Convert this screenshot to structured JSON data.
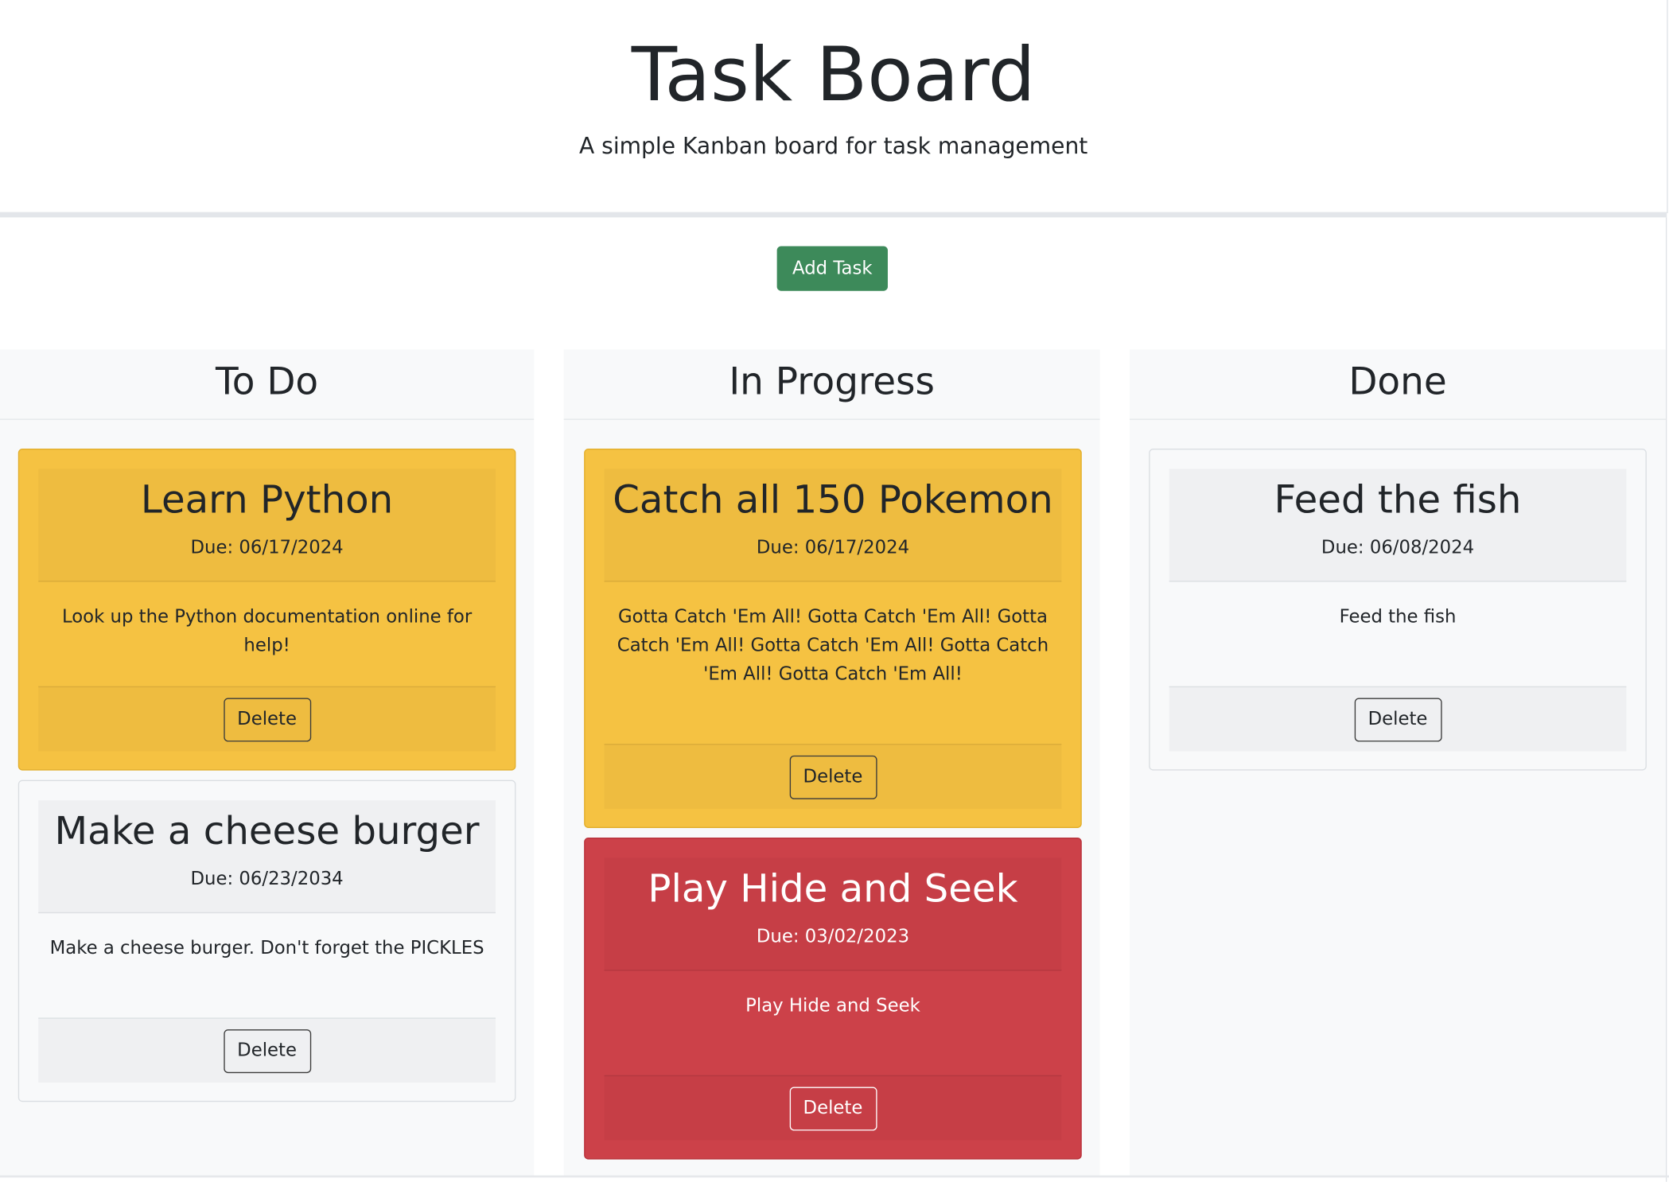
{
  "header": {
    "title": "Task Board",
    "subtitle": "A simple Kanban board for task management"
  },
  "toolbar": {
    "add_task_label": "Add Task"
  },
  "colors": {
    "add_button": "#3d8a5a",
    "warning_card": "#f5c242",
    "overdue_card": "#cc4149",
    "neutral_card": "#f8f9fa"
  },
  "columns": {
    "todo": {
      "title": "To Do",
      "cards": [
        {
          "title": "Learn Python",
          "due": "Due: 06/17/2024",
          "description": "Look up the Python documentation online for help!",
          "delete_label": "Delete"
        },
        {
          "title": "Make a cheese burger",
          "due": "Due: 06/23/2034",
          "description": "Make a cheese burger. Don't forget the PICKLES",
          "delete_label": "Delete"
        }
      ]
    },
    "in_progress": {
      "title": "In Progress",
      "cards": [
        {
          "title": "Catch all 150 Pokemon",
          "due": "Due: 06/17/2024",
          "description": "Gotta Catch 'Em All! Gotta Catch 'Em All! Gotta Catch 'Em All! Gotta Catch 'Em All! Gotta Catch 'Em All! Gotta Catch 'Em All!",
          "delete_label": "Delete"
        },
        {
          "title": "Play Hide and Seek",
          "due": "Due: 03/02/2023",
          "description": "Play Hide and Seek",
          "delete_label": "Delete"
        }
      ]
    },
    "done": {
      "title": "Done",
      "cards": [
        {
          "title": "Feed the fish",
          "due": "Due: 06/08/2024",
          "description": "Feed the fish",
          "delete_label": "Delete"
        }
      ]
    }
  }
}
